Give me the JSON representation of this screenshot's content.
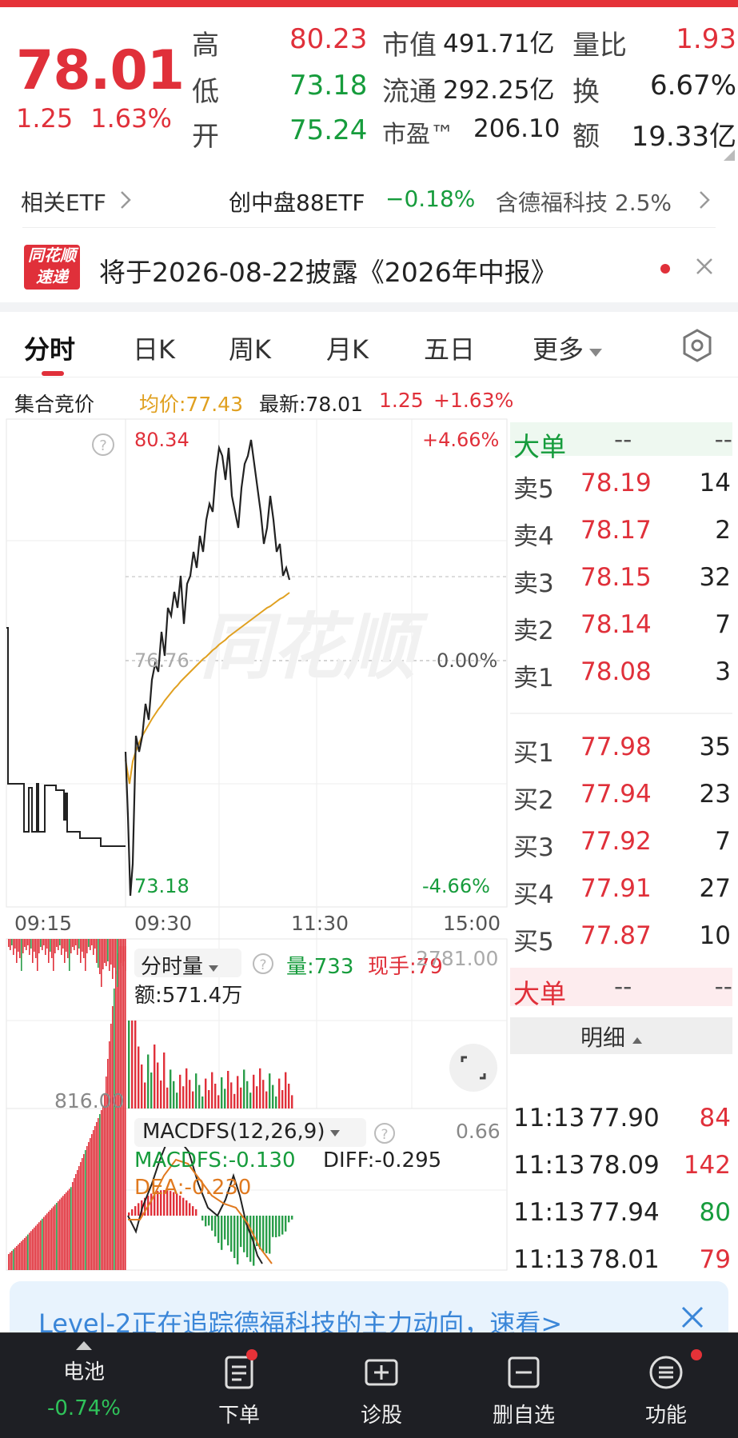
{
  "quote": {
    "price": "78.01",
    "change": "1.25",
    "change_pct": "1.63%",
    "high_label": "高",
    "high": "80.23",
    "low_label": "低",
    "low": "73.18",
    "open_label": "开",
    "open": "75.24",
    "mktcap_label": "市值",
    "mktcap": "491.71亿",
    "float_label": "流通",
    "float": "292.25亿",
    "pe_label": "市盈™",
    "pe": "206.10",
    "volratio_label": "量比",
    "volratio": "1.93",
    "turnover_label": "换",
    "turnover": "6.67%",
    "amount_label": "额",
    "amount": "19.33亿"
  },
  "etf": {
    "label": "相关ETF",
    "name": "创中盘88ETF",
    "change": "−0.18%",
    "holding": "含德福科技 2.5%"
  },
  "news": {
    "logo_line1": "同花顺",
    "logo_line2": "速递",
    "text": "将于2026-08-22披露《2026年中报》"
  },
  "tabs": [
    "分时",
    "日K",
    "周K",
    "月K",
    "五日",
    "更多"
  ],
  "info_bar": {
    "auction": "集合竞价",
    "avg": "均价:77.43",
    "latest": "最新:78.01",
    "chg": "1.25",
    "chg_pct": "+1.63%"
  },
  "chart": {
    "price_top": "80.34",
    "price_mid": "76.76",
    "price_bottom": "73.18",
    "pct_top": "+4.66%",
    "pct_mid": "0.00%",
    "pct_bottom": "-4.66%",
    "time_labels": [
      "09:15",
      "09:30",
      "11:30",
      "15:00"
    ],
    "vol_label": "分时量",
    "vol_value": "量:733",
    "vol_now": "现手:79",
    "vol_amount": "额:571.4万",
    "vol_max": "2781.00",
    "auction_vol": "816.00",
    "macd_label": "MACDFS(12,26,9)",
    "macd_value": "MACDFS:-0.130",
    "diff_value": "DIFF:-0.295",
    "dea_value": "DEA:-0.230",
    "macd_max": "0.66"
  },
  "orderbook": {
    "big_label": "大单",
    "dash": "--",
    "asks": [
      {
        "label": "卖5",
        "price": "78.19",
        "qty": "14"
      },
      {
        "label": "卖4",
        "price": "78.17",
        "qty": "2"
      },
      {
        "label": "卖3",
        "price": "78.15",
        "qty": "32"
      },
      {
        "label": "卖2",
        "price": "78.14",
        "qty": "7"
      },
      {
        "label": "卖1",
        "price": "78.08",
        "qty": "3"
      }
    ],
    "bids": [
      {
        "label": "买1",
        "price": "77.98",
        "qty": "35"
      },
      {
        "label": "买2",
        "price": "77.94",
        "qty": "23"
      },
      {
        "label": "买3",
        "price": "77.92",
        "qty": "7"
      },
      {
        "label": "买4",
        "price": "77.91",
        "qty": "27"
      },
      {
        "label": "买5",
        "price": "77.87",
        "qty": "10"
      }
    ],
    "detail_label": "明细",
    "trades": [
      {
        "time": "11:13",
        "price": "77.90",
        "qty": "84",
        "dir": "up"
      },
      {
        "time": "11:13",
        "price": "78.09",
        "qty": "142",
        "dir": "up"
      },
      {
        "time": "11:13",
        "price": "77.94",
        "qty": "80",
        "dir": "down"
      },
      {
        "time": "11:13",
        "price": "78.01",
        "qty": "79",
        "dir": "up"
      }
    ]
  },
  "banner": {
    "text": "Level-2正在追踪德福科技的主力动向，速看>"
  },
  "bottom": {
    "watch_label": "电池",
    "watch_change": "-0.74%",
    "items": [
      "下单",
      "诊股",
      "删自选",
      "功能"
    ]
  },
  "colors": {
    "up": "#e0303a",
    "down": "#169c3c",
    "avg_line": "#e0a020",
    "price_line": "#222222"
  }
}
